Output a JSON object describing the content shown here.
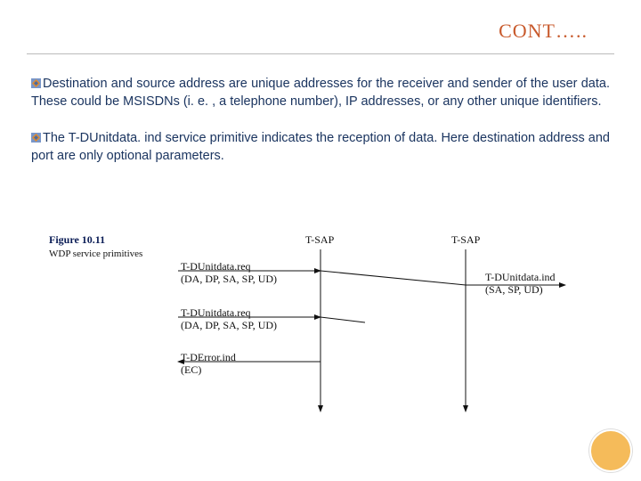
{
  "title": "CONT…..",
  "paragraphs": {
    "p1": "Destination and source address are unique addresses for the receiver and sender of the user data. These could be MSISDNs (i. e. , a telephone number), IP addresses, or any other unique identifiers.",
    "p2": "The T-DUnitdata. ind service primitive indicates the reception of data. Here destination address and port are only optional parameters."
  },
  "figure": {
    "label": "Figure 10.11",
    "subtitle": "WDP service primitives",
    "sap_left": "T-SAP",
    "sap_right": "T-SAP",
    "prim1": "T-DUnitdata.req",
    "prim1_args": "(DA, DP, SA, SP, UD)",
    "prim2": "T-DUnitdata.ind",
    "prim2_args": "(SA, SP, UD)",
    "prim3": "T-DUnitdata.req",
    "prim3_args": "(DA, DP, SA, SP, UD)",
    "prim4": "T-DError.ind",
    "prim4_args": "(EC)"
  }
}
